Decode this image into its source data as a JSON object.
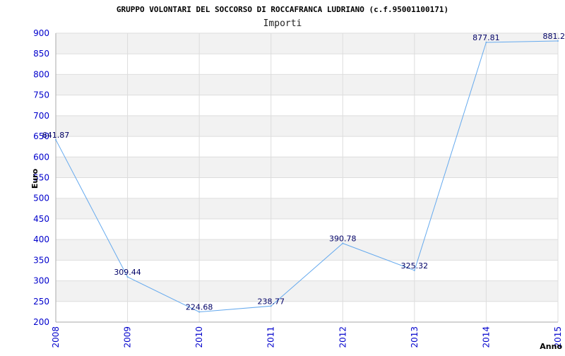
{
  "colors": {
    "line": "#66aaee",
    "tick_label": "#0000cc",
    "data_label": "#000066",
    "band_alt": "#f2f2f2",
    "grid": "#dddddd",
    "axis": "#aaaaaa"
  },
  "chart_data": {
    "type": "line",
    "title": "GRUPPO VOLONTARI DEL SOCCORSO DI ROCCAFRANCA LUDRIANO (c.f.95001100171)",
    "subtitle": "Importi",
    "xlabel": "Anno",
    "ylabel": "Euro",
    "ylim": [
      200,
      900
    ],
    "yticks": [
      200,
      250,
      300,
      350,
      400,
      450,
      500,
      550,
      600,
      650,
      700,
      750,
      800,
      850,
      900
    ],
    "x": [
      "2008",
      "2009",
      "2010",
      "2011",
      "2012",
      "2013",
      "2014",
      "2015"
    ],
    "values": [
      641.87,
      309.44,
      224.68,
      238.77,
      390.78,
      325.32,
      877.81,
      881.2
    ],
    "data_labels": [
      "641.87",
      "309.44",
      "224.68",
      "238.77",
      "390.78",
      "325.32",
      "877.81",
      "881.2"
    ],
    "grid": true,
    "legend": false
  }
}
